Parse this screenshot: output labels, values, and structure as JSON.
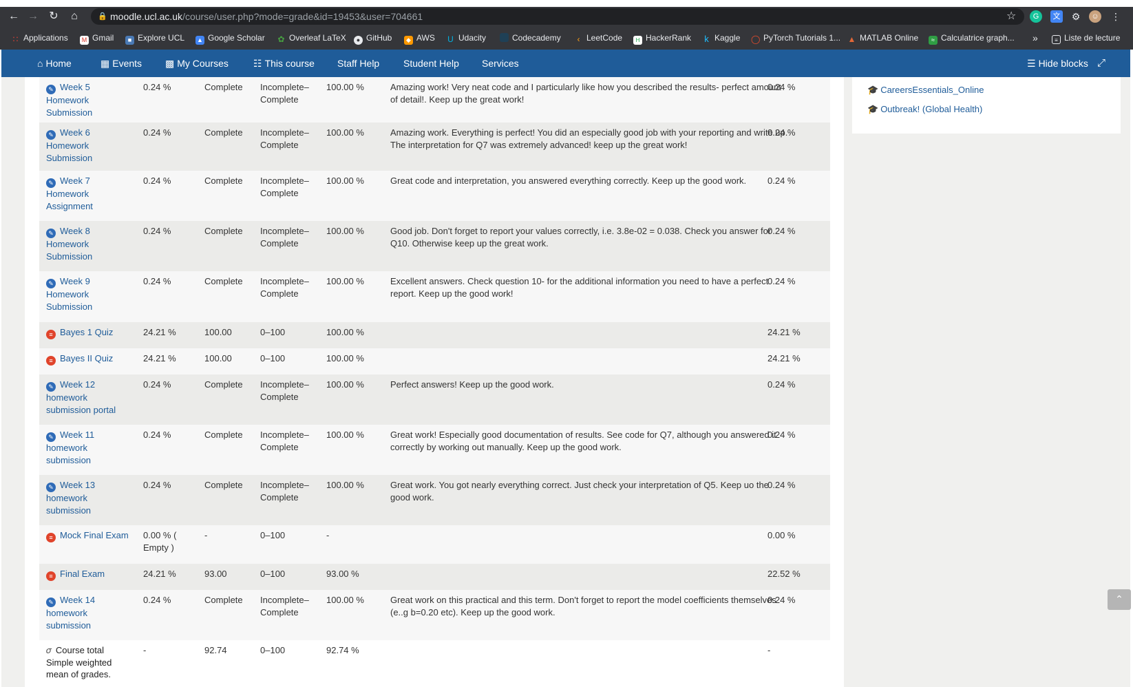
{
  "browser": {
    "url_host": "moodle.ucl.ac.uk",
    "url_path": "/course/user.php?mode=grade&id=19453&user=704661",
    "bookmarks": [
      {
        "label": "Applications",
        "icon": "apps-grid-icon",
        "color": "#e94235"
      },
      {
        "label": "Gmail",
        "icon": "gmail-icon",
        "color": "#d93025"
      },
      {
        "label": "Explore UCL",
        "icon": "ucl-icon",
        "color": "#4a7ab5"
      },
      {
        "label": "Google Scholar",
        "icon": "scholar-icon",
        "color": "#4285f4"
      },
      {
        "label": "Overleaf LaTeX",
        "icon": "overleaf-icon",
        "color": "#47a141"
      },
      {
        "label": "GitHub",
        "icon": "github-icon",
        "color": "#e8eaed"
      },
      {
        "label": "AWS",
        "icon": "aws-icon",
        "color": "#ff9900"
      },
      {
        "label": "Udacity",
        "icon": "udacity-icon",
        "color": "#02b3e4"
      },
      {
        "label": "Codecademy",
        "icon": "codecademy-icon",
        "color": "#1f4056"
      },
      {
        "label": "LeetCode",
        "icon": "leetcode-icon",
        "color": "#ffa116"
      },
      {
        "label": "HackerRank",
        "icon": "hackerrank-icon",
        "color": "#1ba94c"
      },
      {
        "label": "Kaggle",
        "icon": "kaggle-icon",
        "color": "#20beff"
      },
      {
        "label": "PyTorch Tutorials 1...",
        "icon": "pytorch-icon",
        "color": "#ee4c2c"
      },
      {
        "label": "MATLAB Online",
        "icon": "matlab-icon",
        "color": "#e16737"
      },
      {
        "label": "Calculatrice graph...",
        "icon": "desmos-icon",
        "color": "#2f9e44"
      }
    ],
    "more_bookmarks": "»",
    "reading_list": "Liste de lecture"
  },
  "navbar": {
    "home": "Home",
    "events": "Events",
    "my_courses": "My Courses",
    "this_course": "This course",
    "staff_help": "Staff Help",
    "student_help": "Student Help",
    "services": "Services",
    "hide_blocks": "Hide blocks"
  },
  "block": {
    "links": [
      "CareersEssentials_Online",
      "Outbreak! (Global Health)"
    ]
  },
  "grades": [
    {
      "type": "assign",
      "name": "Week 5 Homework Submission",
      "weight": "0.24 %",
      "grade": "Complete",
      "range": "Incomplete–Complete",
      "percentage": "100.00 %",
      "feedback": "Amazing work! Very neat code and I particularly like how you described the results- perfect amount of detail!. Keep up the great work!",
      "contribution": "0.24 %"
    },
    {
      "type": "assign",
      "name": "Week 6 Homework Submission",
      "weight": "0.24 %",
      "grade": "Complete",
      "range": "Incomplete–Complete",
      "percentage": "100.00 %",
      "feedback": "Amazing work. Everything is perfect! You did an especially good job with your reporting and write up. The interpretation for Q7 was extremely advanced! keep up the great work!",
      "contribution": "0.24 %"
    },
    {
      "type": "assign",
      "name": "Week 7 Homework Assignment",
      "weight": "0.24 %",
      "grade": "Complete",
      "range": "Incomplete–Complete",
      "percentage": "100.00 %",
      "feedback": "Great code and interpretation, you answered everything correctly. Keep up the good work.",
      "contribution": "0.24 %"
    },
    {
      "type": "assign",
      "name": "Week 8 Homework Submission",
      "weight": "0.24 %",
      "grade": "Complete",
      "range": "Incomplete–Complete",
      "percentage": "100.00 %",
      "feedback": "Good job. Don't forget to report your values correctly, i.e. 3.8e-02 = 0.038. Check you answer for Q10. Otherwise keep up the great work.",
      "contribution": "0.24 %"
    },
    {
      "type": "assign",
      "name": "Week 9 Homework Submission",
      "weight": "0.24 %",
      "grade": "Complete",
      "range": "Incomplete–Complete",
      "percentage": "100.00 %",
      "feedback": "Excellent answers. Check question 10- for the additional information you need to have a perfect report. Keep up the good work!",
      "contribution": "0.24 %"
    },
    {
      "type": "quiz",
      "name": "Bayes 1 Quiz",
      "weight": "24.21 %",
      "grade": "100.00",
      "range": "0–100",
      "percentage": "100.00 %",
      "feedback": "",
      "contribution": "24.21 %"
    },
    {
      "type": "quiz",
      "name": "Bayes II Quiz",
      "weight": "24.21 %",
      "grade": "100.00",
      "range": "0–100",
      "percentage": "100.00 %",
      "feedback": "",
      "contribution": "24.21 %"
    },
    {
      "type": "assign",
      "name": "Week 12 homework submission portal",
      "weight": "0.24 %",
      "grade": "Complete",
      "range": "Incomplete–Complete",
      "percentage": "100.00 %",
      "feedback": "Perfect answers! Keep up the good work.",
      "contribution": "0.24 %"
    },
    {
      "type": "assign",
      "name": "Week 11 homework submission",
      "weight": "0.24 %",
      "grade": "Complete",
      "range": "Incomplete–Complete",
      "percentage": "100.00 %",
      "feedback": "Great work! Especially good documentation of results. See code for Q7, although you answered it correctly by working out manually. Keep up the good work.",
      "contribution": "0.24 %"
    },
    {
      "type": "assign",
      "name": "Week 13 homework submission",
      "weight": "0.24 %",
      "grade": "Complete",
      "range": "Incomplete–Complete",
      "percentage": "100.00 %",
      "feedback": "Great work. You got nearly everything correct. Just check your interpretation of Q5. Keep uo the good work.",
      "contribution": "0.24 %"
    },
    {
      "type": "quiz",
      "name": "Mock Final Exam",
      "weight": "0.00 % ( Empty )",
      "grade": "-",
      "range": "0–100",
      "percentage": "-",
      "feedback": "",
      "contribution": "0.00 %"
    },
    {
      "type": "quiz",
      "name": "Final Exam",
      "weight": "24.21 %",
      "grade": "93.00",
      "range": "0–100",
      "percentage": "93.00 %",
      "feedback": "",
      "contribution": "22.52 %"
    },
    {
      "type": "assign",
      "name": "Week 14 homework submission",
      "weight": "0.24 %",
      "grade": "Complete",
      "range": "Incomplete–Complete",
      "percentage": "100.00 %",
      "feedback": "Great work on this practical and this term. Don't forget to report the model coefficients themselves (e..g b=0.20 etc). Keep up the good work.",
      "contribution": "0.24 %"
    }
  ],
  "total": {
    "name": "Course total",
    "subtitle": "Simple weighted mean of grades.",
    "weight": "-",
    "grade": "92.74",
    "range": "0–100",
    "percentage": "92.74 %",
    "contribution": "-"
  }
}
